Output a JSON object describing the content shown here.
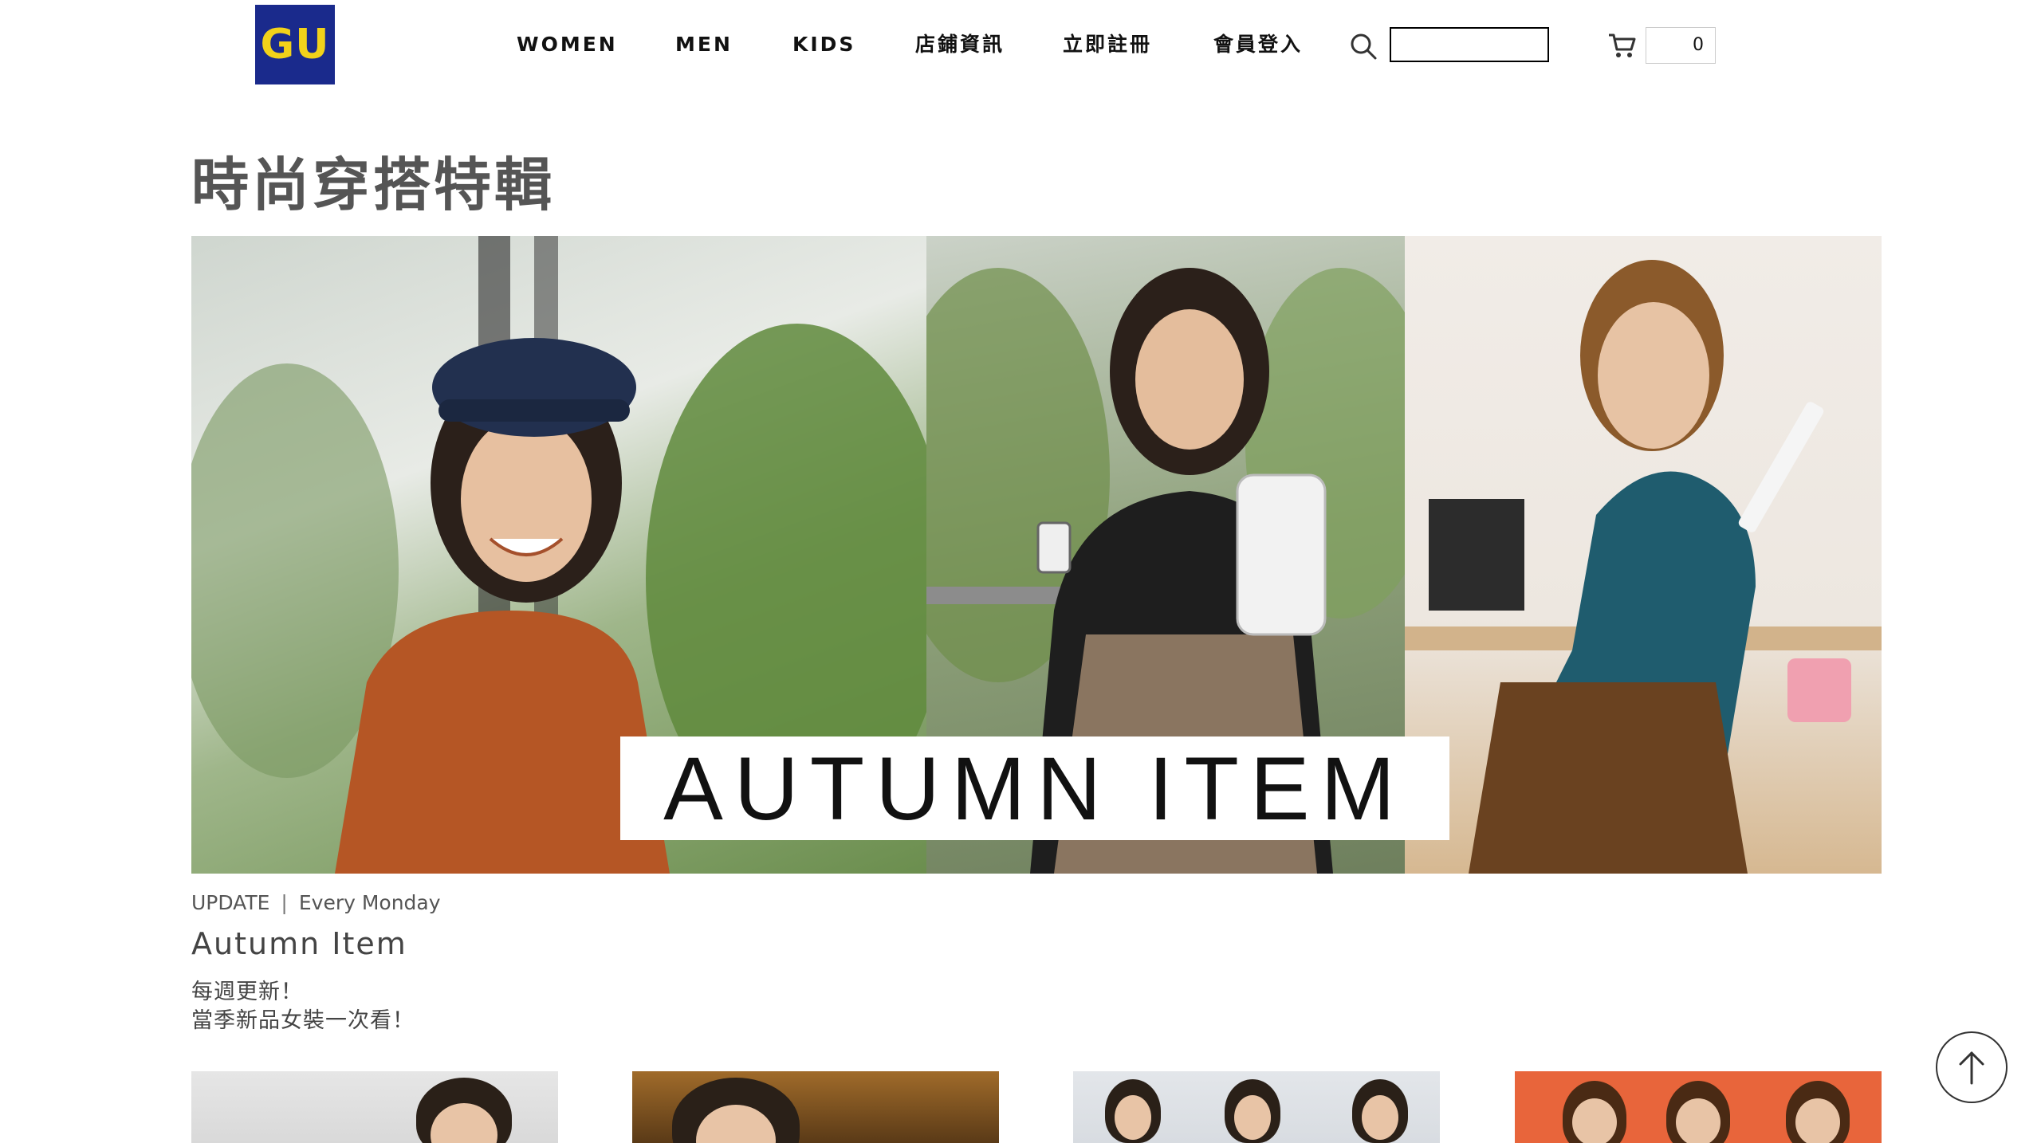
{
  "header": {
    "logo_text": "GU",
    "nav": [
      "WOMEN",
      "MEN",
      "KIDS",
      "店鋪資訊",
      "立即註冊",
      "會員登入"
    ],
    "search": {
      "value": "",
      "placeholder": ""
    },
    "cart_count": "0"
  },
  "page": {
    "title": "時尚穿搭特輯"
  },
  "hero": {
    "banner_text": "AUTUMN ITEM"
  },
  "feature": {
    "update_label": "UPDATE",
    "divider": "|",
    "schedule": "Every Monday",
    "title": "Autumn Item",
    "desc_line1": "每週更新！",
    "desc_line2": "當季新品女裝一次看！"
  },
  "colors": {
    "logo_bg": "#1a2a8c",
    "logo_text": "#f2d21a",
    "title_gray": "#555555"
  },
  "icons": {
    "search": "search-icon",
    "cart": "cart-icon",
    "back_to_top": "arrow-up-icon"
  }
}
